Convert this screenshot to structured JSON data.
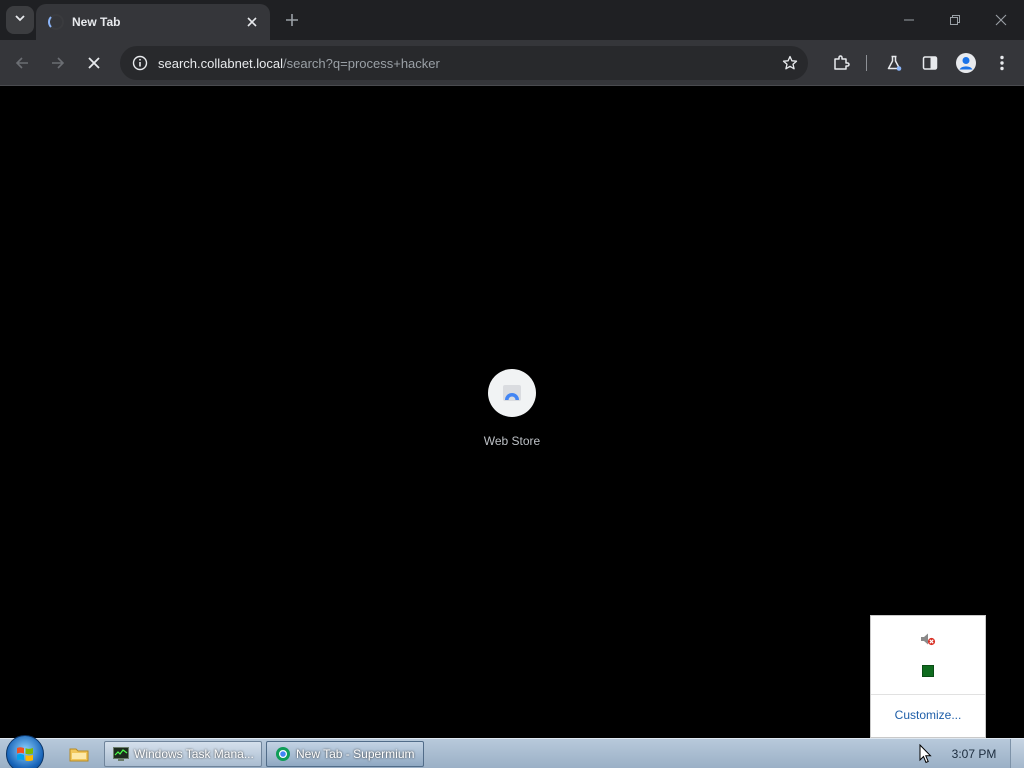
{
  "browser": {
    "tab": {
      "title": "New Tab"
    },
    "omnibox": {
      "host": "search.collabnet.local",
      "path": "/search?q=process+hacker"
    }
  },
  "content": {
    "shortcut": {
      "label": "Web Store"
    }
  },
  "tray_popup": {
    "customize_label": "Customize..."
  },
  "taskbar": {
    "items": [
      {
        "label": "Windows Task Mana..."
      },
      {
        "label": "New Tab - Supermium"
      }
    ],
    "clock": "3:07 PM"
  },
  "colors": {
    "chrome_dark": "#1f2023",
    "toolbar": "#35363a",
    "content_bg": "#000000",
    "accent": "#8ab4f8"
  }
}
